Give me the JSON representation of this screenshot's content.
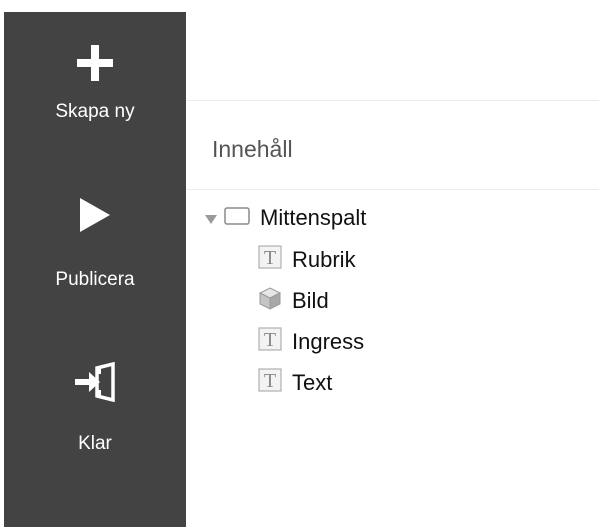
{
  "sidebar": {
    "background": "#434343",
    "actions": [
      {
        "label": "Skapa ny",
        "icon": "plus-icon"
      },
      {
        "label": "Publicera",
        "icon": "play-icon"
      },
      {
        "label": "Klar",
        "icon": "exit-door-icon"
      }
    ]
  },
  "content": {
    "title": "Innehåll",
    "tree": {
      "root": {
        "label": "Mittenspalt",
        "icon": "container-box-icon",
        "expanded": true
      },
      "children": [
        {
          "label": "Rubrik",
          "icon": "text-icon"
        },
        {
          "label": "Bild",
          "icon": "cube-image-icon"
        },
        {
          "label": "Ingress",
          "icon": "text-icon"
        },
        {
          "label": "Text",
          "icon": "text-icon"
        }
      ]
    }
  }
}
